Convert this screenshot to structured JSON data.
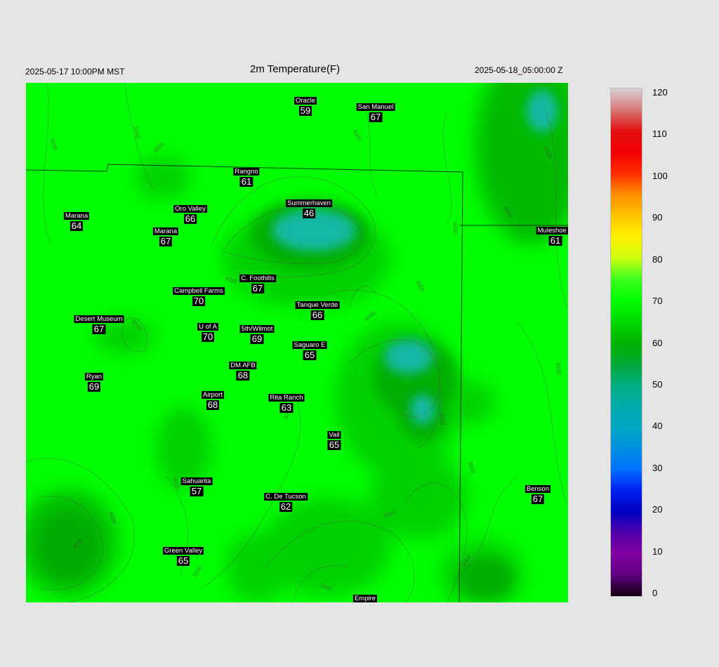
{
  "header": {
    "left": "2025-05-17 10:00PM MST",
    "title": "2m Temperature(F)",
    "right": "2025-05-18_05:00:00 Z"
  },
  "stations": [
    {
      "name": "Oracle",
      "value": "59"
    },
    {
      "name": "San Manuel",
      "value": "67"
    },
    {
      "name": "Rangno",
      "value": "61"
    },
    {
      "name": "Marana",
      "value": "64"
    },
    {
      "name": "Oro Valley",
      "value": "66"
    },
    {
      "name": "Summerhaven",
      "value": "46"
    },
    {
      "name": "Marana",
      "value": "67"
    },
    {
      "name": "Muleshoe R",
      "value": "61"
    },
    {
      "name": "C. Foothills",
      "value": "67"
    },
    {
      "name": "Campbell Farms",
      "value": "70"
    },
    {
      "name": "Tanque Verde",
      "value": "66"
    },
    {
      "name": "Desert Museum",
      "value": "67"
    },
    {
      "name": "U of A",
      "value": "70"
    },
    {
      "name": "5th/Wilmot",
      "value": "69"
    },
    {
      "name": "Saguaro E",
      "value": "65"
    },
    {
      "name": "DM AFB",
      "value": "68"
    },
    {
      "name": "Ryan",
      "value": "69"
    },
    {
      "name": "Airport",
      "value": "68"
    },
    {
      "name": "Rita Ranch",
      "value": "63"
    },
    {
      "name": "Vail",
      "value": "65"
    },
    {
      "name": "Sahuarita",
      "value": "57"
    },
    {
      "name": "C. De Tucson",
      "value": "62"
    },
    {
      "name": "Benson",
      "value": "67"
    },
    {
      "name": "Green Valley",
      "value": "65"
    },
    {
      "name": "Empire",
      "value": ""
    }
  ],
  "contour_labels": [
    "3000",
    "4000",
    "5000"
  ],
  "colorbar": {
    "ticks": [
      "120",
      "110",
      "100",
      "90",
      "80",
      "70",
      "60",
      "50",
      "40",
      "30",
      "20",
      "10",
      "0"
    ],
    "colors": {
      "120": "#d6d0d6",
      "115": "#d87a7a",
      "110": "#e01010",
      "105": "#f00000",
      "100": "#ff2a00",
      "95": "#ff8c00",
      "90": "#ffc400",
      "85": "#fff000",
      "80": "#d0ff10",
      "75": "#40ff20",
      "70": "#00ff00",
      "65": "#00d800",
      "60": "#00b400",
      "55": "#00a830",
      "50": "#00b080",
      "45": "#00aaaa",
      "40": "#00a8c0",
      "35": "#0090e0",
      "30": "#0070ff",
      "25": "#0020f0",
      "20": "#0000c0",
      "15": "#5000a8",
      "10": "#8000a0",
      "5": "#600080",
      "0": "#100010"
    }
  },
  "map_colors": {
    "base": "#00ff00",
    "mid": "#00d000",
    "dark": "#00a800",
    "cold": "#14b8a6"
  }
}
